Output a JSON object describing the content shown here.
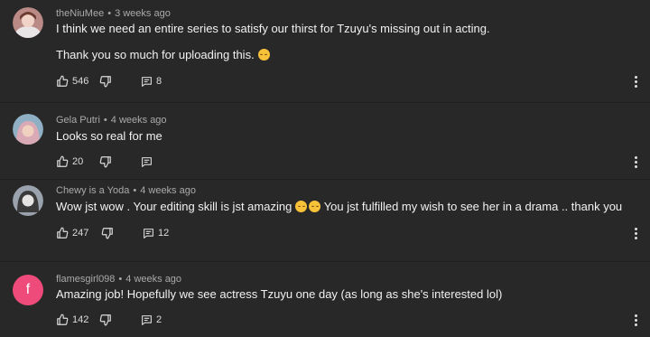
{
  "comments": [
    {
      "author": "theNiuMee",
      "time": "3 weeks ago",
      "lines": [
        "I think we need an entire series to satisfy our thirst for Tzuyu's missing out in acting.",
        "Thank you so much for uploading this."
      ],
      "likes": "546",
      "replies": "8",
      "avatar_color": "#b98a86"
    },
    {
      "author": "Gela Putri",
      "time": "4 weeks ago",
      "lines": [
        "Looks so real for me"
      ],
      "likes": "20",
      "replies": "",
      "avatar_color": "#8fb0c4"
    },
    {
      "author": "Chewy is a Yoda",
      "time": "4 weeks ago",
      "line_a": "Wow jst wow . Your editing skill is jst amazing",
      "line_b": " You jst fulfilled my wish to see her in a drama .. thank you",
      "likes": "247",
      "replies": "12",
      "avatar_color": "#9aa3ad"
    },
    {
      "author": "flamesgirl098",
      "time": "4 weeks ago",
      "lines": [
        "Amazing job! Hopefully we see actress Tzuyu one day (as long as she's interested lol)"
      ],
      "likes": "142",
      "replies": "2",
      "avatar_letter": "f",
      "avatar_color": "#ef4b7a"
    }
  ],
  "icons": {
    "like": "thumbs-up-icon",
    "dislike": "thumbs-down-icon",
    "reply": "reply-icon",
    "more": "more-vertical-icon",
    "emoji": "grinning-sweat-emoji-icon"
  },
  "colors": {
    "background": "#282828",
    "text": "#f1f1f1",
    "meta": "#aaaaaa"
  }
}
